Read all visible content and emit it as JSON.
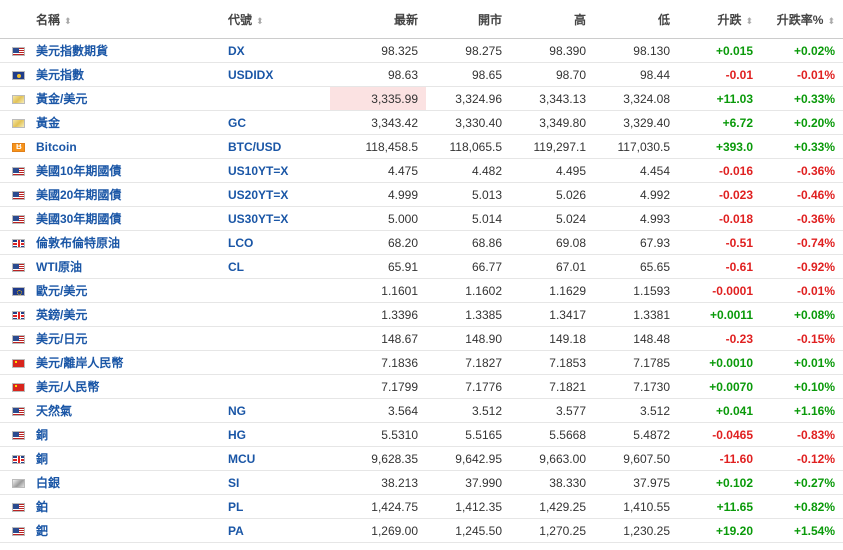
{
  "headers": {
    "name": "名稱",
    "code": "代號",
    "last": "最新",
    "open": "開市",
    "high": "高",
    "low": "低",
    "change": "升跌",
    "change_pct": "升跌率%",
    "sort_glyph": "⬍"
  },
  "rows": [
    {
      "flag": "us",
      "name": "美元指數期貨",
      "code": "DX",
      "last": "98.325",
      "open": "98.275",
      "high": "98.390",
      "low": "98.130",
      "change": "+0.015",
      "pct": "+0.02%",
      "dir": "pos"
    },
    {
      "flag": "asia",
      "name": "美元指數",
      "code": "USDIDX",
      "last": "98.63",
      "open": "98.65",
      "high": "98.70",
      "low": "98.44",
      "change": "-0.01",
      "pct": "-0.01%",
      "dir": "neg"
    },
    {
      "flag": "gold",
      "name": "黃金/美元",
      "code": "",
      "last": "3,335.99",
      "open": "3,324.96",
      "high": "3,343.13",
      "low": "3,324.08",
      "change": "+11.03",
      "pct": "+0.33%",
      "dir": "pos",
      "highlight": true
    },
    {
      "flag": "gold",
      "name": "黃金",
      "code": "GC",
      "last": "3,343.42",
      "open": "3,330.40",
      "high": "3,349.80",
      "low": "3,329.40",
      "change": "+6.72",
      "pct": "+0.20%",
      "dir": "pos"
    },
    {
      "flag": "btc",
      "name": "Bitcoin",
      "code": "BTC/USD",
      "last": "118,458.5",
      "open": "118,065.5",
      "high": "119,297.1",
      "low": "117,030.5",
      "change": "+393.0",
      "pct": "+0.33%",
      "dir": "pos"
    },
    {
      "flag": "us",
      "name": "美國10年期國債",
      "code": "US10YT=X",
      "last": "4.475",
      "open": "4.482",
      "high": "4.495",
      "low": "4.454",
      "change": "-0.016",
      "pct": "-0.36%",
      "dir": "neg"
    },
    {
      "flag": "us",
      "name": "美國20年期國債",
      "code": "US20YT=X",
      "last": "4.999",
      "open": "5.013",
      "high": "5.026",
      "low": "4.992",
      "change": "-0.023",
      "pct": "-0.46%",
      "dir": "neg"
    },
    {
      "flag": "us",
      "name": "美國30年期國債",
      "code": "US30YT=X",
      "last": "5.000",
      "open": "5.014",
      "high": "5.024",
      "low": "4.993",
      "change": "-0.018",
      "pct": "-0.36%",
      "dir": "neg"
    },
    {
      "flag": "gb",
      "name": "倫敦布倫特原油",
      "code": "LCO",
      "last": "68.20",
      "open": "68.86",
      "high": "69.08",
      "low": "67.93",
      "change": "-0.51",
      "pct": "-0.74%",
      "dir": "neg"
    },
    {
      "flag": "us",
      "name": "WTI原油",
      "code": "CL",
      "last": "65.91",
      "open": "66.77",
      "high": "67.01",
      "low": "65.65",
      "change": "-0.61",
      "pct": "-0.92%",
      "dir": "neg"
    },
    {
      "flag": "eu",
      "name": "歐元/美元",
      "code": "",
      "last": "1.1601",
      "open": "1.1602",
      "high": "1.1629",
      "low": "1.1593",
      "change": "-0.0001",
      "pct": "-0.01%",
      "dir": "neg"
    },
    {
      "flag": "gb",
      "name": "英鎊/美元",
      "code": "",
      "last": "1.3396",
      "open": "1.3385",
      "high": "1.3417",
      "low": "1.3381",
      "change": "+0.0011",
      "pct": "+0.08%",
      "dir": "pos"
    },
    {
      "flag": "us",
      "name": "美元/日元",
      "code": "",
      "last": "148.67",
      "open": "148.90",
      "high": "149.18",
      "low": "148.48",
      "change": "-0.23",
      "pct": "-0.15%",
      "dir": "neg"
    },
    {
      "flag": "cn",
      "name": "美元/離岸人民幣",
      "code": "",
      "last": "7.1836",
      "open": "7.1827",
      "high": "7.1853",
      "low": "7.1785",
      "change": "+0.0010",
      "pct": "+0.01%",
      "dir": "pos"
    },
    {
      "flag": "cn",
      "name": "美元/人民幣",
      "code": "",
      "last": "7.1799",
      "open": "7.1776",
      "high": "7.1821",
      "low": "7.1730",
      "change": "+0.0070",
      "pct": "+0.10%",
      "dir": "pos"
    },
    {
      "flag": "us",
      "name": "天然氣",
      "code": "NG",
      "last": "3.564",
      "open": "3.512",
      "high": "3.577",
      "low": "3.512",
      "change": "+0.041",
      "pct": "+1.16%",
      "dir": "pos"
    },
    {
      "flag": "us",
      "name": "銅",
      "code": "HG",
      "last": "5.5310",
      "open": "5.5165",
      "high": "5.5668",
      "low": "5.4872",
      "change": "-0.0465",
      "pct": "-0.83%",
      "dir": "neg"
    },
    {
      "flag": "gb",
      "name": "銅",
      "code": "MCU",
      "last": "9,628.35",
      "open": "9,642.95",
      "high": "9,663.00",
      "low": "9,607.50",
      "change": "-11.60",
      "pct": "-0.12%",
      "dir": "neg"
    },
    {
      "flag": "silver",
      "name": "白銀",
      "code": "SI",
      "last": "38.213",
      "open": "37.990",
      "high": "38.330",
      "low": "37.975",
      "change": "+0.102",
      "pct": "+0.27%",
      "dir": "pos"
    },
    {
      "flag": "us",
      "name": "鉑",
      "code": "PL",
      "last": "1,424.75",
      "open": "1,412.35",
      "high": "1,429.25",
      "low": "1,410.55",
      "change": "+11.65",
      "pct": "+0.82%",
      "dir": "pos"
    },
    {
      "flag": "us",
      "name": "鈀",
      "code": "PA",
      "last": "1,269.00",
      "open": "1,245.50",
      "high": "1,270.25",
      "low": "1,230.25",
      "change": "+19.20",
      "pct": "+1.54%",
      "dir": "pos"
    }
  ]
}
